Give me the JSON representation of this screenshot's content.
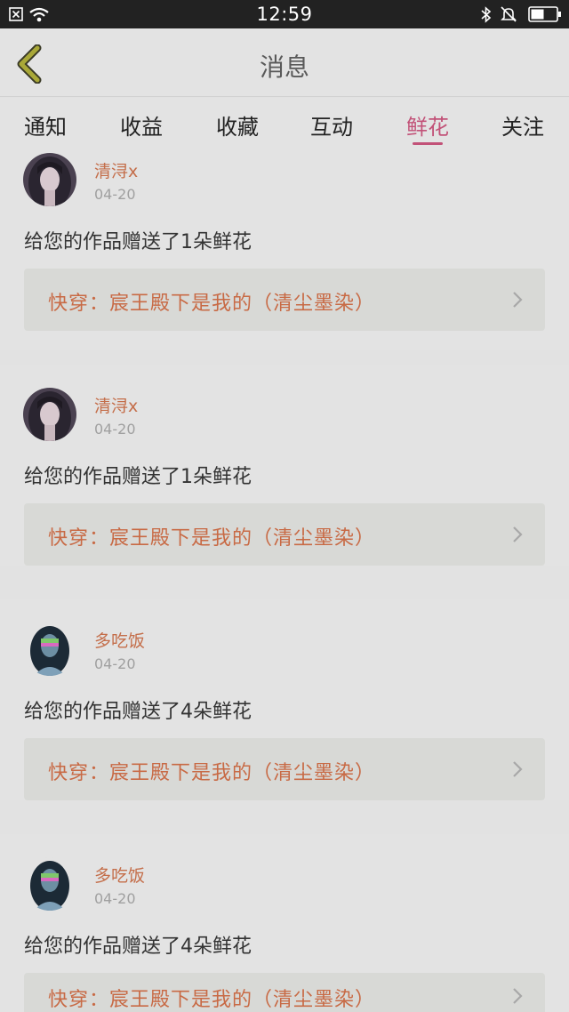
{
  "status_bar": {
    "time": "12:59"
  },
  "header": {
    "title": "消息"
  },
  "tabs": [
    {
      "label": "通知"
    },
    {
      "label": "收益"
    },
    {
      "label": "收藏"
    },
    {
      "label": "互动"
    },
    {
      "label": "鲜花",
      "active": true
    },
    {
      "label": "关注"
    }
  ],
  "colors": {
    "accent": "#c25278",
    "username": "#c46e4a",
    "link_text": "#c86a45"
  },
  "messages": [
    {
      "user": "清浔x",
      "date": "04-20",
      "text": "给您的作品赠送了1朵鲜花",
      "work": "快穿：宸王殿下是我的（清尘墨染）",
      "avatar": "girl-avatar"
    },
    {
      "user": "清浔x",
      "date": "04-20",
      "text": "给您的作品赠送了1朵鲜花",
      "work": "快穿：宸王殿下是我的（清尘墨染）",
      "avatar": "girl-avatar"
    },
    {
      "user": "多吃饭",
      "date": "04-20",
      "text": "给您的作品赠送了4朵鲜花",
      "work": "快穿：宸王殿下是我的（清尘墨染）",
      "avatar": "boy-avatar"
    },
    {
      "user": "多吃饭",
      "date": "04-20",
      "text": "给您的作品赠送了4朵鲜花",
      "work": "快穿：宸王殿下是我的（清尘墨染）",
      "avatar": "boy-avatar"
    }
  ]
}
